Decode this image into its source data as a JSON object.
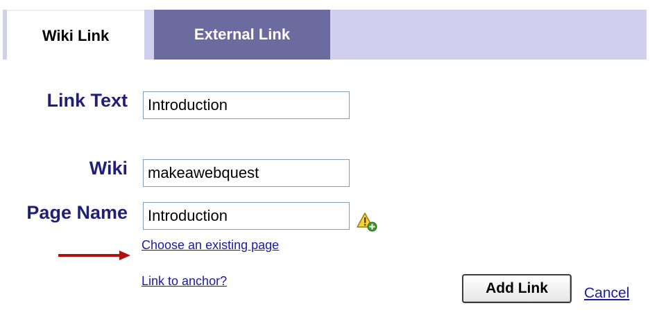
{
  "tabs": {
    "wiki_link": "Wiki Link",
    "external_link": "External Link"
  },
  "form": {
    "link_text_label": "Link Text",
    "link_text_value": "Introduction",
    "wiki_label": "Wiki",
    "wiki_value": "makeawebquest",
    "page_name_label": "Page Name",
    "page_name_value": "Introduction",
    "choose_existing_page": "Choose an existing page",
    "link_to_anchor": "Link to anchor?"
  },
  "actions": {
    "add_link": "Add Link",
    "cancel": "Cancel"
  },
  "colors": {
    "tab_bar": "#d0d0ee",
    "inactive_tab": "#6b6b9f",
    "label": "#1f1f7a",
    "link": "#1a1aa6",
    "arrow": "#b01010"
  },
  "icons": {
    "page_warning": "warning-add-icon",
    "annotation_arrow": "red-arrow"
  }
}
